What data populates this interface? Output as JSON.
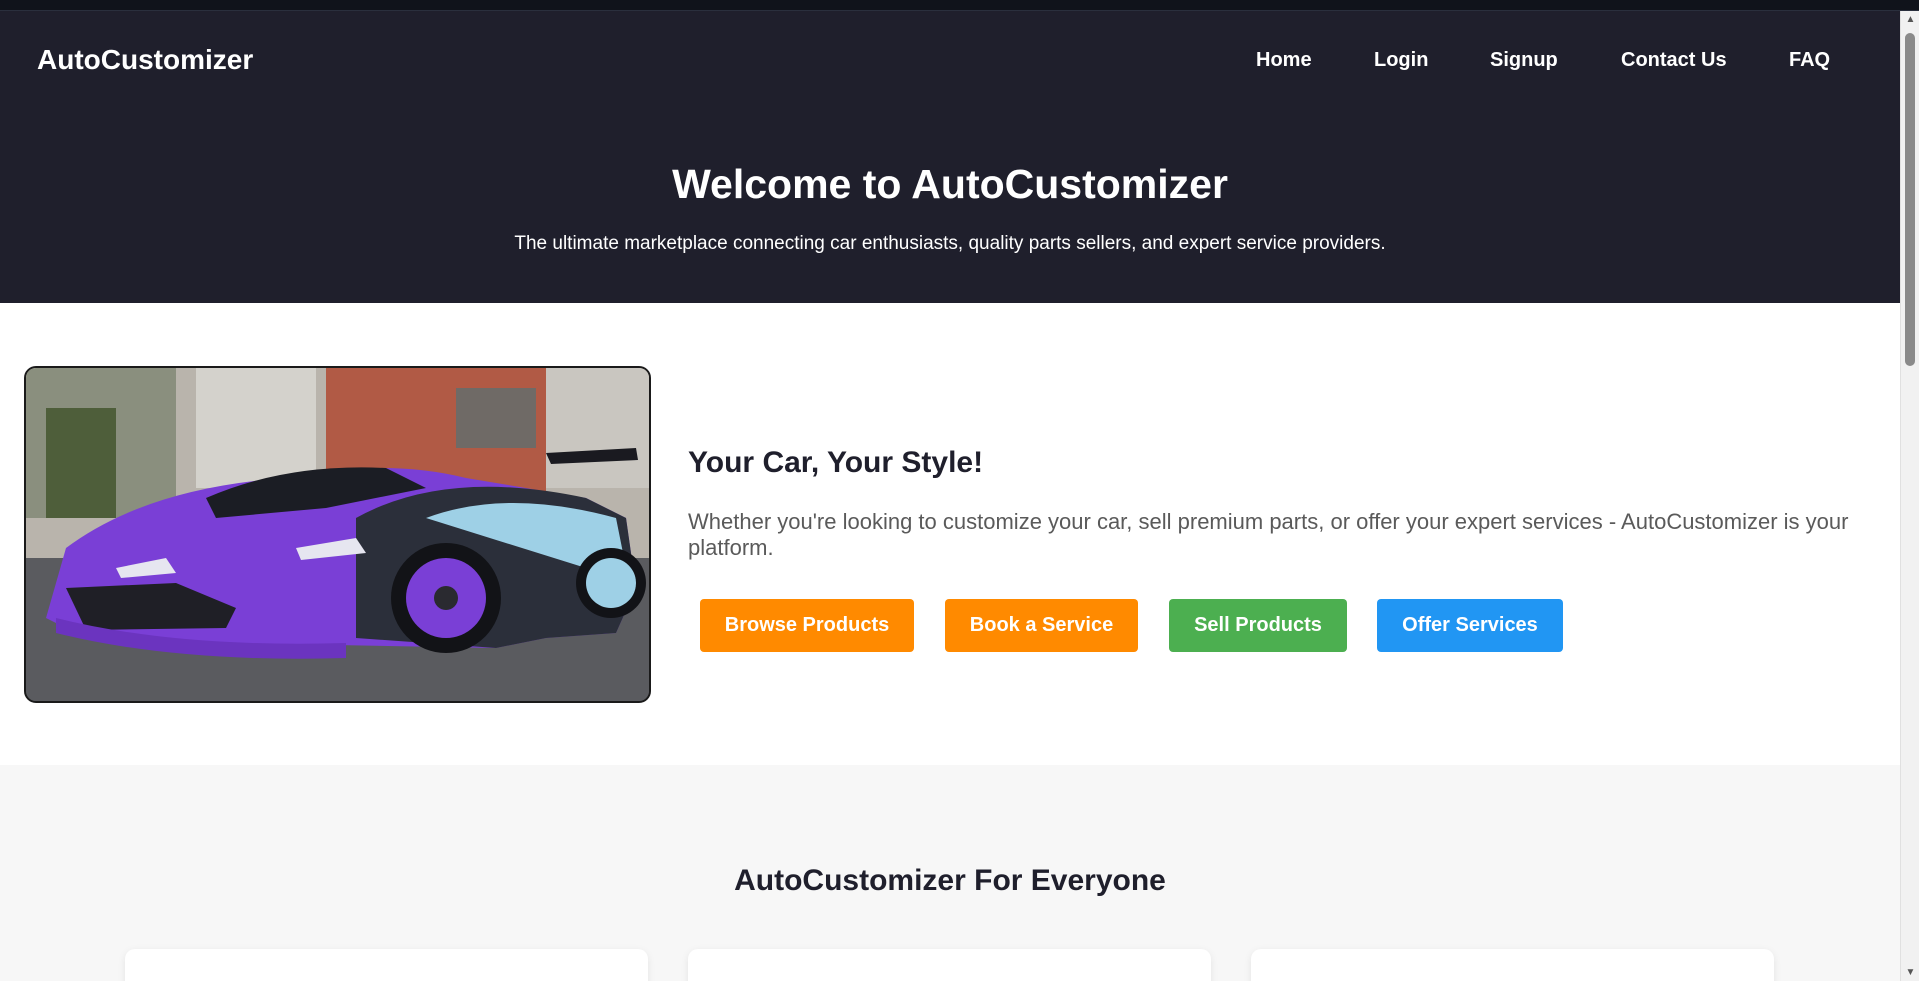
{
  "header": {
    "logo": "AutoCustomizer",
    "nav": [
      {
        "label": "Home"
      },
      {
        "label": "Login"
      },
      {
        "label": "Signup"
      },
      {
        "label": "Contact Us"
      },
      {
        "label": "FAQ"
      }
    ],
    "hero_title": "Welcome to AutoCustomizer",
    "hero_subtitle": "The ultimate marketplace connecting car enthusiasts, quality parts sellers, and expert service providers."
  },
  "feature": {
    "title": "Your Car, Your Style!",
    "text": "Whether you're looking to customize your car, sell premium parts, or offer your expert services - AutoCustomizer is your platform.",
    "buttons": [
      {
        "label": "Browse Products",
        "color": "#ff8a00"
      },
      {
        "label": "Book a Service",
        "color": "#ff8a00"
      },
      {
        "label": "Sell Products",
        "color": "#4caf50"
      },
      {
        "label": "Offer Services",
        "color": "#2196f3"
      }
    ]
  },
  "everyone": {
    "title": "AutoCustomizer For Everyone"
  },
  "colors": {
    "header_bg": "#1f1f2c",
    "section_bg": "#f7f7f7"
  }
}
